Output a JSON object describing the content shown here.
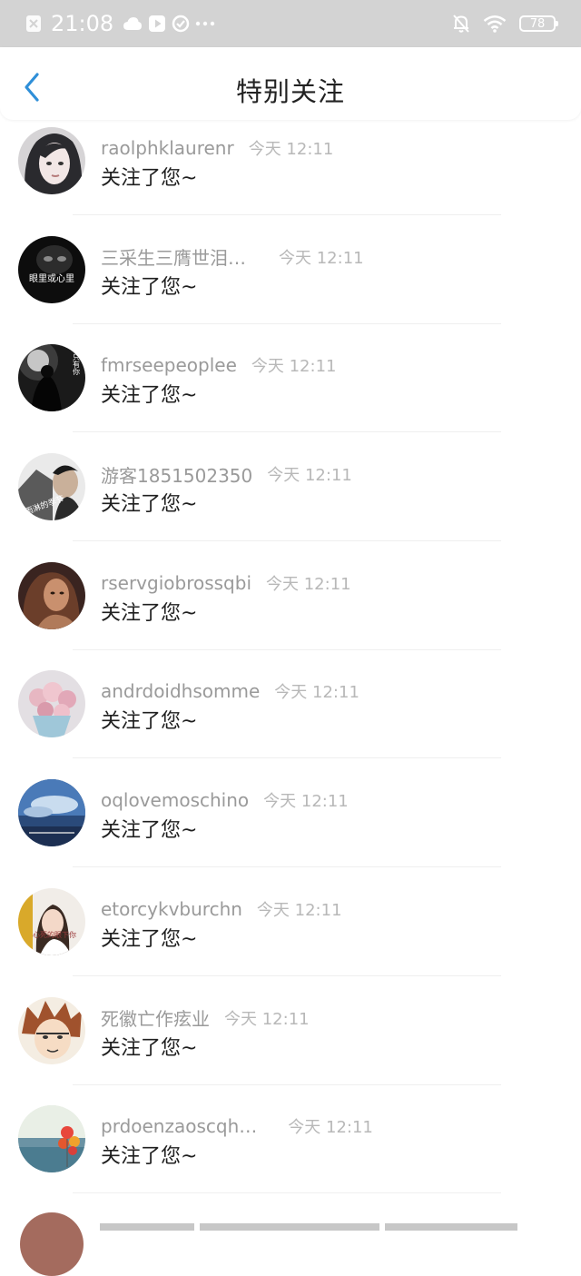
{
  "status_bar": {
    "time": "21:08",
    "battery": "78",
    "icons": [
      "notification-x-icon",
      "cloud-icon",
      "play-icon",
      "sync-icon",
      "more-dots-icon",
      "bell-muted-icon",
      "wifi-icon",
      "battery-icon"
    ]
  },
  "nav": {
    "title": "特别关注",
    "back_icon": "chevron-left-icon",
    "accent": "#2f8fd8"
  },
  "items": [
    {
      "username": "raolphklaurenr",
      "time": "今天 12:11",
      "message": "关注了您~"
    },
    {
      "username": "三采生三膺世泪…",
      "time": "今天 12:11",
      "message": "关注了您~"
    },
    {
      "username": "fmrseepeoplee",
      "time": "今天 12:11",
      "message": "关注了您~"
    },
    {
      "username": "游客1851502350",
      "time": "今天 12:11",
      "message": "关注了您~"
    },
    {
      "username": "rservgiobrossqbi",
      "time": "今天 12:11",
      "message": "关注了您~"
    },
    {
      "username": "andrdoidhsomme",
      "time": "今天 12:11",
      "message": "关注了您~"
    },
    {
      "username": "oqlovemoschino",
      "time": "今天 12:11",
      "message": "关注了您~"
    },
    {
      "username": "etorcykvburchn",
      "time": "今天 12:11",
      "message": "关注了您~"
    },
    {
      "username": "死徽亡作痃业",
      "time": "今天 12:11",
      "message": "关注了您~"
    },
    {
      "username": "prdoenzaoscqh…",
      "time": "今天 12:11",
      "message": "关注了您~"
    }
  ],
  "avatar_labels": {
    "item_2": "眼里或心里",
    "item_3": "只有你",
    "item_4": "雨淋的季节",
    "item_8": "心死的眼下你"
  },
  "colors": {
    "status_bar_bg": "#d3d3d3",
    "username": "#9a9a9a",
    "timestamp": "#b8b8b8",
    "message": "#1f1f1f"
  }
}
